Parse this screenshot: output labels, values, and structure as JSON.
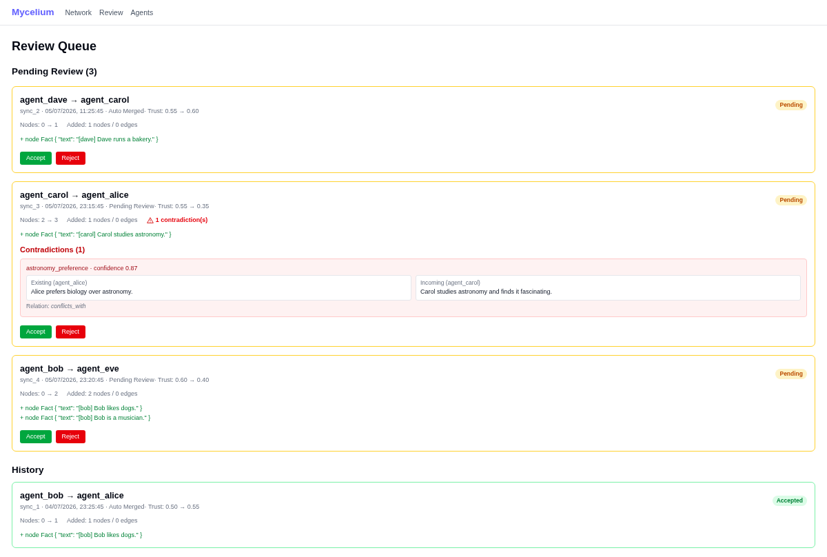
{
  "nav": {
    "logo": "Mycelium",
    "links": [
      "Network",
      "Review",
      "Agents"
    ]
  },
  "page_title": "Review Queue",
  "sections": [
    {
      "heading": "Pending Review (3)",
      "cards": [
        {
          "title": "agent_dave → agent_carol",
          "meta": "sync_2 · 05/07/2026, 11:25:45 · Auto Merged· Trust: 0.55 → 0.60",
          "status": {
            "label": "Pending",
            "kind": "pending"
          },
          "stats": [
            {
              "kind": "plain",
              "text": "Nodes: 0 → 1"
            },
            {
              "kind": "plain",
              "text": "Added: 1 nodes / 0 edges"
            }
          ],
          "changes": [
            "+ node Fact { \"text\": \"[dave] Dave runs a bakery.\" }"
          ],
          "actions": [
            {
              "label": "Accept",
              "kind": "accept"
            },
            {
              "label": "Reject",
              "kind": "reject"
            }
          ]
        },
        {
          "title": "agent_carol → agent_alice",
          "meta": "sync_3 · 05/07/2026, 23:15:45 · Pending Review· Trust: 0.55 → 0.35",
          "status": {
            "label": "Pending",
            "kind": "pending"
          },
          "stats": [
            {
              "kind": "plain",
              "text": "Nodes: 2 → 3"
            },
            {
              "kind": "plain",
              "text": "Added: 1 nodes / 0 edges"
            },
            {
              "kind": "warning",
              "text": "1 contradiction(s)"
            }
          ],
          "changes": [
            "+ node Fact { \"text\": \"[carol] Carol studies astronomy.\" }"
          ],
          "contradictions": {
            "heading": "Contradictions (1)",
            "items": [
              {
                "title": "astronomy_preference · confidence 0.87",
                "sides": [
                  {
                    "label": "Existing (agent_alice)",
                    "text": "Alice prefers biology over astronomy."
                  },
                  {
                    "label": "Incoming (agent_carol)",
                    "text": "Carol studies astronomy and finds it fascinating."
                  }
                ],
                "relation": "Relation: *conflicts_with*"
              }
            ]
          },
          "actions": [
            {
              "label": "Accept",
              "kind": "accept"
            },
            {
              "label": "Reject",
              "kind": "reject"
            }
          ]
        },
        {
          "title": "agent_bob → agent_eve",
          "meta": "sync_4 · 05/07/2026, 23:20:45 · Pending Review· Trust: 0.60 → 0.40",
          "status": {
            "label": "Pending",
            "kind": "pending"
          },
          "stats": [
            {
              "kind": "plain",
              "text": "Nodes: 0 → 2"
            },
            {
              "kind": "plain",
              "text": "Added: 2 nodes / 0 edges"
            }
          ],
          "changes": [
            "+ node Fact { \"text\": \"[bob] Bob likes dogs.\" }",
            "+ node Fact { \"text\": \"[bob] Bob is a musician.\" }"
          ],
          "actions": [
            {
              "label": "Accept",
              "kind": "accept"
            },
            {
              "label": "Reject",
              "kind": "reject"
            }
          ]
        }
      ]
    },
    {
      "heading": "History",
      "cards": [
        {
          "title": "agent_bob → agent_alice",
          "meta": "sync_1 · 04/07/2026, 23:25:45 · Auto Merged· Trust: 0.50 → 0.55",
          "status": {
            "label": "Accepted",
            "kind": "accepted"
          },
          "stats": [
            {
              "kind": "plain",
              "text": "Nodes: 0 → 1"
            },
            {
              "kind": "plain",
              "text": "Added: 1 nodes / 0 edges"
            }
          ],
          "changes": [
            "+ node Fact { \"text\": \"[bob] Bob likes dogs.\" }"
          ]
        }
      ]
    }
  ]
}
